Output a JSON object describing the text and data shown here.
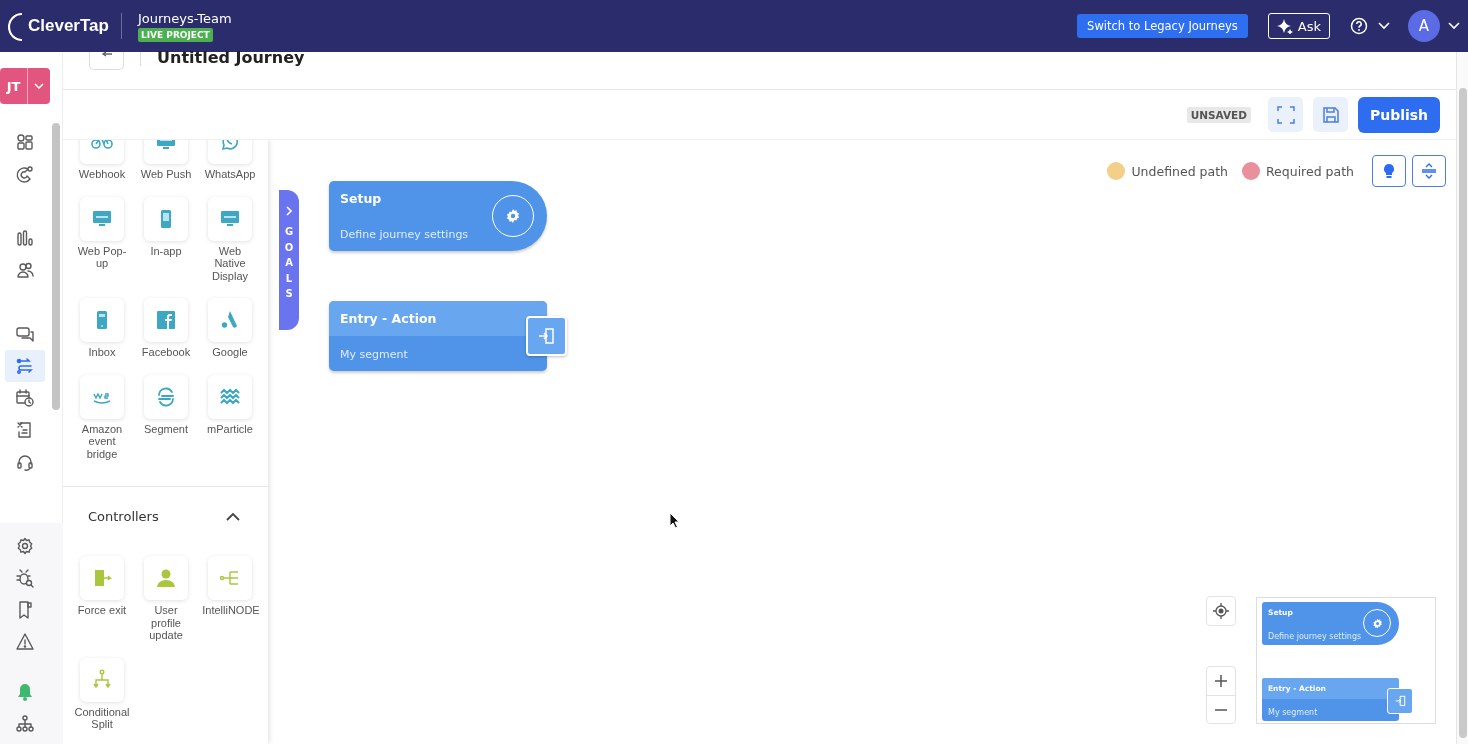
{
  "header": {
    "logo": "CleverTap",
    "project": "Journeys-Team",
    "badge": "LIVE PROJECT",
    "legacy_button": "Switch to Legacy Journeys",
    "ask_button": "Ask",
    "avatar": "A"
  },
  "rail": {
    "account": "JT",
    "top": [
      [
        {
          "kind": "grid",
          "selected": false
        },
        {
          "kind": "magnet",
          "selected": false
        }
      ],
      [
        {
          "kind": "bars",
          "selected": false
        },
        {
          "kind": "users",
          "selected": false
        }
      ],
      [
        {
          "kind": "chat",
          "selected": false
        },
        {
          "kind": "journey",
          "selected": true
        },
        {
          "kind": "calendar",
          "selected": false
        },
        {
          "kind": "report",
          "selected": false
        },
        {
          "kind": "headset",
          "selected": false
        }
      ]
    ],
    "bottom": [
      [
        {
          "kind": "gear",
          "selected": false
        },
        {
          "kind": "bug",
          "selected": false
        },
        {
          "kind": "bookmark",
          "selected": false
        },
        {
          "kind": "warning",
          "selected": false
        }
      ],
      [
        {
          "kind": "bell",
          "selected": false
        },
        {
          "kind": "hierarchy",
          "selected": false
        }
      ]
    ]
  },
  "journey": {
    "title": "Untitled Journey",
    "status": "UNSAVED",
    "publish": "Publish"
  },
  "palette": {
    "channels": [
      {
        "kind": "bike",
        "label": "Webhook"
      },
      {
        "kind": "monitor",
        "label": "Web Push"
      },
      {
        "kind": "whatsapp",
        "label": "WhatsApp"
      },
      {
        "kind": "monitor",
        "label": "Web Pop-up"
      },
      {
        "kind": "phone",
        "label": "In-app"
      },
      {
        "kind": "monitor",
        "label": "Web Native Display"
      },
      {
        "kind": "inbox",
        "label": "Inbox"
      },
      {
        "kind": "facebook",
        "label": "Facebook"
      },
      {
        "kind": "google",
        "label": "Google"
      },
      {
        "kind": "aws",
        "label": "Amazon event bridge"
      },
      {
        "kind": "segment",
        "label": "Segment"
      },
      {
        "kind": "waves",
        "label": "mParticle"
      }
    ],
    "sections": [
      {
        "title": "Controllers",
        "expanded": true,
        "items": [
          {
            "kind": "exit",
            "label": "Force exit"
          },
          {
            "kind": "person",
            "label": "User profile update"
          },
          {
            "kind": "tree",
            "label": "IntelliNODE"
          },
          {
            "kind": "split",
            "label": "Conditional Split"
          }
        ]
      }
    ]
  },
  "goals_tab": {
    "label": "GOALS"
  },
  "legend": [
    {
      "label": "Undefined path",
      "color": "#f3cf8a"
    },
    {
      "label": "Required path",
      "color": "#e8909c"
    }
  ],
  "nodes": [
    {
      "kind": "setup",
      "title": "Setup",
      "subtitle": "Define journey settings"
    },
    {
      "kind": "entry",
      "title": "Entry - Action",
      "subtitle": "My segment"
    }
  ],
  "minimap": {
    "nodes": [
      {
        "kind": "setup",
        "title": "Setup",
        "subtitle": "Define journey settings"
      },
      {
        "kind": "entry",
        "title": "Entry - Action",
        "subtitle": "My segment"
      }
    ]
  }
}
